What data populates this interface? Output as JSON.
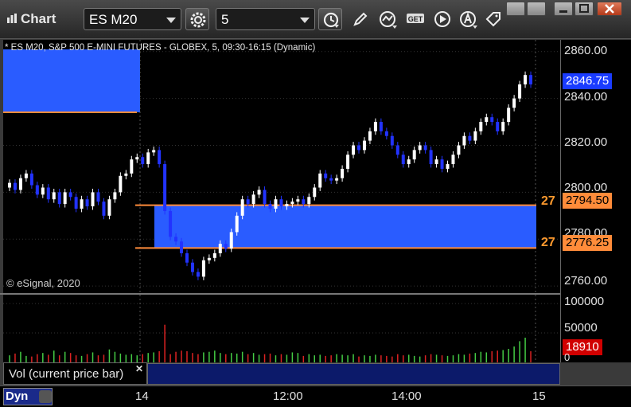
{
  "toolbar": {
    "app_title": "Chart",
    "symbol": "ES M20",
    "interval": "5",
    "icons": [
      "settings-icon",
      "clock-icon",
      "pencil-icon",
      "indicator-icon",
      "get-icon",
      "play-icon",
      "alert-icon",
      "tag-icon"
    ]
  },
  "window": {
    "controls": [
      "restore",
      "minimize",
      "maximize",
      "close"
    ]
  },
  "chart": {
    "title": "* ES M20, S&P 500 E-MINI FUTURES - GLOBEX, 5, 09:30-16:15 (Dynamic)",
    "copyright": "© eSignal, 2020",
    "last_price": "2846.75",
    "levels": [
      {
        "price": "2794.50",
        "label": "27"
      },
      {
        "price": "2776.25",
        "label": "27"
      }
    ],
    "y_ticks": [
      "2860.00",
      "2840.00",
      "2820.00",
      "2800.00",
      "2780.00",
      "2760.00"
    ],
    "colors": {
      "up": "#ffffff",
      "down": "#2233ff",
      "zone": "#2a5cff",
      "level": "#ff8c3a"
    }
  },
  "volume": {
    "label": "Vol (current price bar)",
    "last": "18910",
    "y_ticks": [
      "100000",
      "50000",
      "0"
    ]
  },
  "time_axis": {
    "labels": [
      "14",
      "12:00",
      "14:00",
      "15"
    ],
    "mode": "Dyn"
  },
  "chart_data": {
    "type": "candlestick",
    "title": "* ES M20, S&P 500 E-MINI FUTURES - GLOBEX, 5, 09:30-16:15 (Dynamic)",
    "ylim": [
      2757,
      2865
    ],
    "x_ticks": [
      "14",
      "12:00",
      "14:00",
      "15"
    ],
    "y_ticks": [
      2860,
      2840,
      2820,
      2800,
      2780,
      2760
    ],
    "levels": [
      2794.5,
      2776.25
    ],
    "last_price": 2846.75,
    "closes": [
      2804,
      2801,
      2806,
      2808,
      2803,
      2799,
      2802,
      2797,
      2800,
      2795,
      2800,
      2798,
      2793,
      2797,
      2794,
      2800,
      2796,
      2790,
      2797,
      2800,
      2807,
      2808,
      2814,
      2815,
      2812,
      2817,
      2818,
      2812,
      2792,
      2781,
      2779,
      2774,
      2770,
      2766,
      2764,
      2771,
      2772,
      2774,
      2778,
      2776,
      2783,
      2790,
      2797,
      2795,
      2799,
      2801,
      2795,
      2793,
      2797,
      2794,
      2795,
      2796,
      2797,
      2795,
      2798,
      2802,
      2808,
      2806,
      2805,
      2806,
      2810,
      2816,
      2820,
      2818,
      2822,
      2826,
      2830,
      2826,
      2824,
      2820,
      2816,
      2812,
      2814,
      2818,
      2820,
      2818,
      2812,
      2814,
      2810,
      2812,
      2816,
      2820,
      2824,
      2822,
      2826,
      2830,
      2832,
      2830,
      2826,
      2830,
      2836,
      2840,
      2846,
      2850,
      2846
    ],
    "volumes": [
      12000,
      15000,
      18000,
      11000,
      10000,
      14000,
      16000,
      13000,
      20000,
      12000,
      18000,
      16000,
      12000,
      11000,
      14000,
      17000,
      12000,
      13000,
      22000,
      18000,
      15000,
      13000,
      14000,
      12000,
      14000,
      16000,
      17000,
      19000,
      64000,
      14000,
      18000,
      20000,
      19000,
      16000,
      14000,
      17000,
      18000,
      20000,
      16000,
      14000,
      16000,
      15000,
      18000,
      14000,
      16000,
      13000,
      14000,
      15000,
      12000,
      14000,
      13000,
      17000,
      16000,
      11000,
      14000,
      12000,
      13000,
      11000,
      12000,
      14000,
      13000,
      12000,
      14000,
      10000,
      12000,
      11000,
      13000,
      12000,
      11000,
      10000,
      14000,
      12000,
      13000,
      11000,
      10000,
      12000,
      14000,
      13000,
      12000,
      11000,
      12000,
      14000,
      13000,
      15000,
      16000,
      18000,
      17000,
      19000,
      20000,
      21000,
      23000,
      27000,
      36000,
      42000,
      18910
    ]
  }
}
